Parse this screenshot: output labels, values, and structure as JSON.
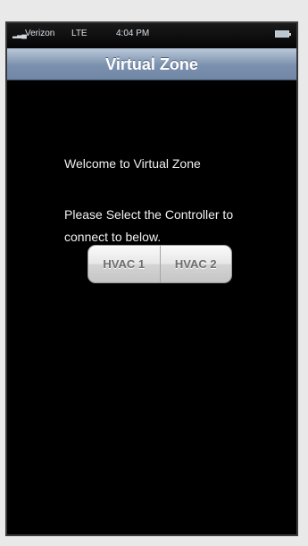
{
  "status_bar": {
    "signal_icon": "signal-bars-icon",
    "carrier": "Verizon",
    "network": "LTE",
    "time": "4:04 PM",
    "battery_icon": "battery-icon"
  },
  "nav_bar": {
    "title": "Virtual Zone",
    "gradient_colors": [
      "#b8c6d7",
      "#6f86a5"
    ]
  },
  "content": {
    "welcome_text": "Welcome to Virtual Zone",
    "instruction_text": "Please Select the Controller to connect to below."
  },
  "controller_selector": {
    "options": [
      {
        "label": "HVAC 1"
      },
      {
        "label": "HVAC 2"
      }
    ]
  },
  "colors": {
    "background": "#000000",
    "text": "#f0f0f0",
    "segment_text": "#6d6d6d"
  }
}
